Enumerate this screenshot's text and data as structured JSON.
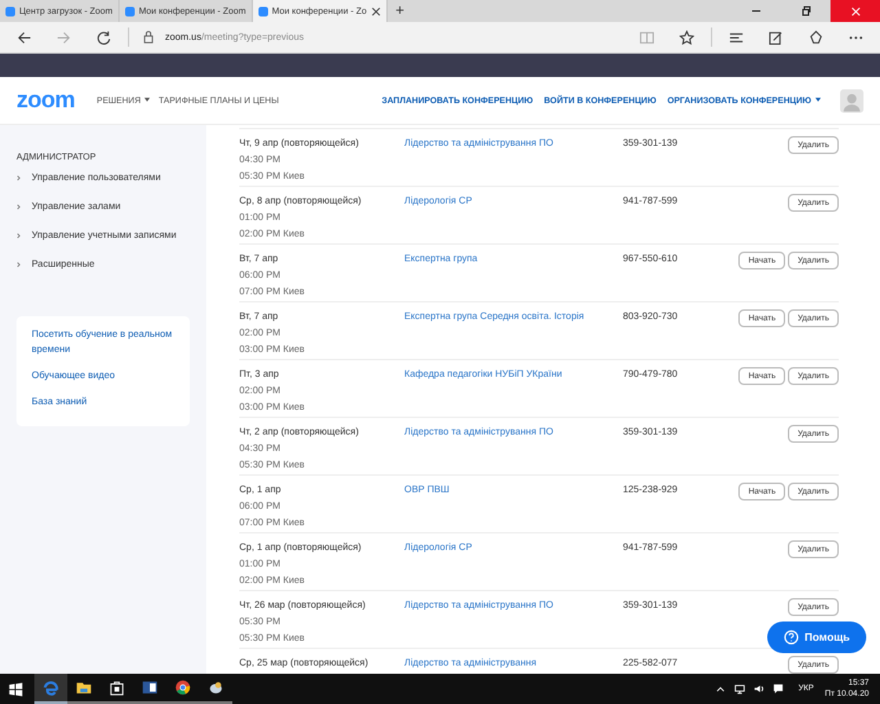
{
  "browser": {
    "tabs": [
      {
        "title": "Центр загрузок - Zoom",
        "selected": false
      },
      {
        "title": "Мои конференции - Zoom",
        "selected": false
      },
      {
        "title": "Мои конференции - Zo",
        "selected": true
      }
    ],
    "new_tab": "+",
    "url": {
      "host": "zoom.us",
      "path": "/meeting?type=previous"
    }
  },
  "header": {
    "logo": "zoom",
    "nav": [
      {
        "label": "РЕШЕНИЯ",
        "dropdown": true
      },
      {
        "label": "ТАРИФНЫЕ ПЛАНЫ И ЦЕНЫ",
        "dropdown": false
      }
    ],
    "actions": [
      {
        "label": "ЗАПЛАНИРОВАТЬ КОНФЕРЕНЦИЮ",
        "dropdown": false
      },
      {
        "label": "ВОЙТИ В КОНФЕРЕНЦИЮ",
        "dropdown": false
      },
      {
        "label": "ОРГАНИЗОВАТЬ КОНФЕРЕНЦИЮ",
        "dropdown": true
      }
    ]
  },
  "sidebar": {
    "section_title": "АДМИНИСТРАТОР",
    "items": [
      "Управление пользователями",
      "Управление залами",
      "Управление учетными записями",
      "Расширенные"
    ],
    "links": [
      "Посетить обучение в реальном времени",
      "Обучающее видео",
      "База знаний"
    ]
  },
  "meetings": [
    {
      "date": "Чт, 9 апр (повторяющейся)",
      "start": "04:30 PM",
      "end": "05:30 PM Киев",
      "topic": "Лідерство та адміністрування ПО",
      "id": "359-301-139",
      "buttons": [
        "Удалить"
      ]
    },
    {
      "date": "Ср, 8 апр (повторяющейся)",
      "start": "01:00 PM",
      "end": "02:00 PM Киев",
      "topic": "Лідерологія СР",
      "id": "941-787-599",
      "buttons": [
        "Удалить"
      ]
    },
    {
      "date": "Вт, 7 апр",
      "start": "06:00 PM",
      "end": "07:00 PM Киев",
      "topic": "Експертна група",
      "id": "967-550-610",
      "buttons": [
        "Начать",
        "Удалить"
      ]
    },
    {
      "date": "Вт, 7 апр",
      "start": "02:00 PM",
      "end": "03:00 PM Киев",
      "topic": "Експертна група Середня освіта. Історія",
      "id": "803-920-730",
      "buttons": [
        "Начать",
        "Удалить"
      ]
    },
    {
      "date": "Пт, 3 апр",
      "start": "02:00 PM",
      "end": "03:00 PM Киев",
      "topic": "Кафедра педагогіки НУБіП УКраїни",
      "id": "790-479-780",
      "buttons": [
        "Начать",
        "Удалить"
      ]
    },
    {
      "date": "Чт, 2 апр (повторяющейся)",
      "start": "04:30 PM",
      "end": "05:30 PM Киев",
      "topic": "Лідерство та адміністрування ПО",
      "id": "359-301-139",
      "buttons": [
        "Удалить"
      ]
    },
    {
      "date": "Ср, 1 апр",
      "start": "06:00 PM",
      "end": "07:00 PM Киев",
      "topic": "ОВР ПВШ",
      "id": "125-238-929",
      "buttons": [
        "Начать",
        "Удалить"
      ]
    },
    {
      "date": "Ср, 1 апр (повторяющейся)",
      "start": "01:00 PM",
      "end": "02:00 PM Киев",
      "topic": "Лідерологія СР",
      "id": "941-787-599",
      "buttons": [
        "Удалить"
      ]
    },
    {
      "date": "Чт, 26 мар (повторяющейся)",
      "start": "05:30 PM",
      "end": "05:30 PM Киев",
      "topic": "Лідерство та адміністрування ПО",
      "id": "359-301-139",
      "buttons": [
        "Удалить"
      ]
    },
    {
      "date": "Ср, 25 мар (повторяющейся)",
      "topic": "Лідерство та адміністрування",
      "id": "225-582-077",
      "buttons": [
        "Удалить"
      ]
    }
  ],
  "help_button": "Помощь",
  "taskbar": {
    "language": "УКР",
    "time": "15:37",
    "date": "Пт 10.04.20"
  }
}
